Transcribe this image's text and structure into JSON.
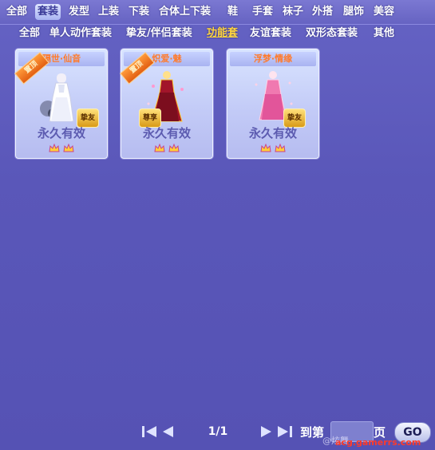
{
  "categories": [
    "全部",
    "套装",
    "发型",
    "上装",
    "下装",
    "合体上下装",
    "鞋",
    "手套",
    "袜子",
    "外搭",
    "腿饰",
    "美容"
  ],
  "active_category": "套装",
  "subcategories": [
    "全部",
    "单人动作套装",
    "挚友/伴侣套装",
    "功能套",
    "友谊套装",
    "双形态套装",
    "其他"
  ],
  "active_subcategory": "功能套",
  "items": [
    {
      "name": "隔世·仙音",
      "ribbon": "置顶",
      "duration": "永久有效",
      "badge": "挚友",
      "colors": {
        "dress": "#ffffff",
        "accent": "#9aa3c8"
      }
    },
    {
      "name": "炽爱·魅",
      "ribbon": "置顶",
      "duration": "永久有效",
      "badge": "尊享",
      "colors": {
        "dress": "#a2152a",
        "accent": "#ffcc33"
      }
    },
    {
      "name": "浮梦·情缘",
      "ribbon": "",
      "duration": "永久有效",
      "badge": "挚友",
      "colors": {
        "dress": "#f079b0",
        "accent": "#ffd1e6"
      }
    }
  ],
  "pager": {
    "page_text": "1/1",
    "goto_label": "到第",
    "page_suffix": "页",
    "go_label": "GO"
  },
  "watermark": "@炫舞",
  "site": "acg.gamerrs.com"
}
